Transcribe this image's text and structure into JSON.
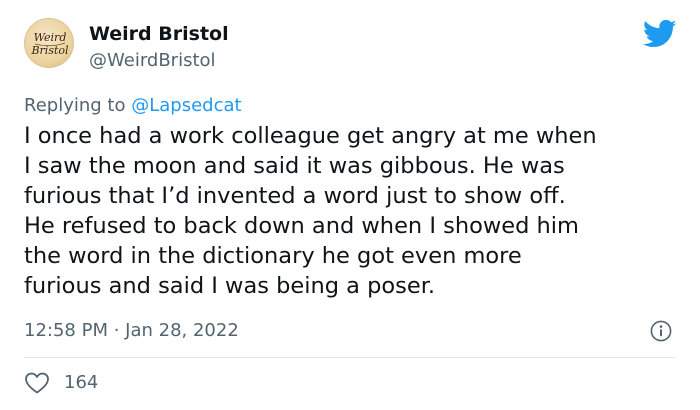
{
  "author": {
    "display_name": "Weird Bristol",
    "handle": "@WeirdBristol",
    "avatar_text_top": "Weird",
    "avatar_text_bottom": "Bristol"
  },
  "reply": {
    "prefix": "Replying to ",
    "mention": "@Lapsedcat"
  },
  "tweet": {
    "lines": [
      "I once had a work colleague get angry at me when",
      "I saw the moon and said it was gibbous. He was",
      "furious that I’d invented a word just to show off.",
      "He refused to back down and when I showed him",
      "the word in the dictionary he got even more",
      "furious and said I was being a poser."
    ]
  },
  "meta": {
    "timestamp": "12:58 PM · Jan 28, 2022"
  },
  "stats": {
    "likes": "164"
  },
  "icons": {
    "logo": "twitter-bird-icon",
    "info": "info-icon",
    "like": "heart-icon"
  },
  "colors": {
    "text": "#0f1419",
    "secondary": "#536471",
    "accent": "#1d9bf0",
    "divider": "#e1e8ed"
  }
}
